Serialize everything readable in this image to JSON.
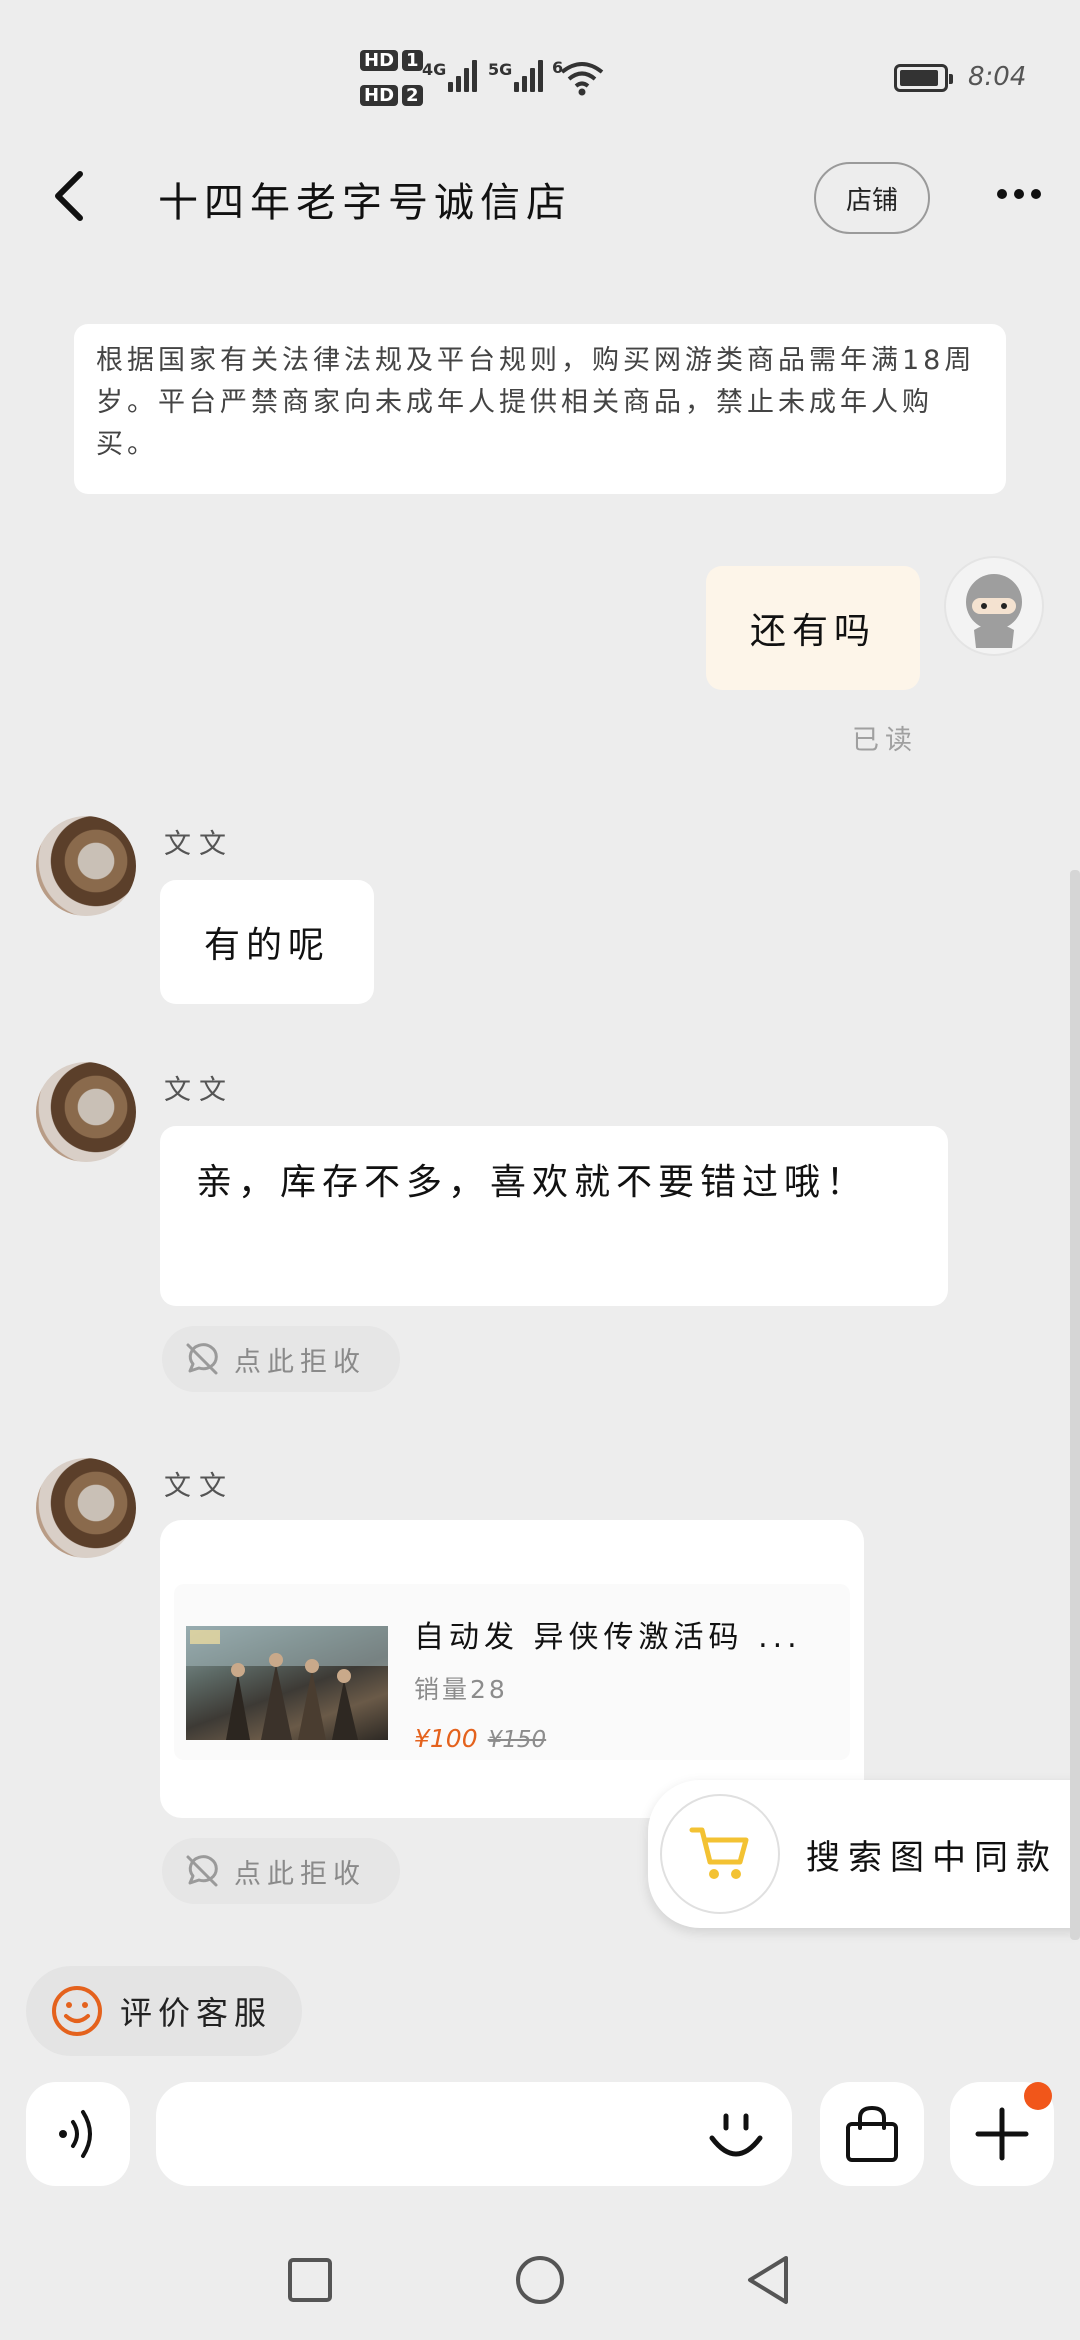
{
  "status_bar": {
    "hd1": "HD",
    "hd1_num": "1",
    "hd2": "HD",
    "hd2_num": "2",
    "signal1": "4G",
    "signal2": "5G",
    "wifi": "6",
    "time": "8:04"
  },
  "header": {
    "title": "十四年老字号诚信店",
    "shop_button": "店铺"
  },
  "notice": {
    "text": "根据国家有关法律法规及平台规则，购买网游类商品需年满18周岁。平台严禁商家向未成年人提供相关商品，禁止未成年人购买。"
  },
  "messages": {
    "me": {
      "text": "还有吗",
      "status": "已读"
    },
    "reply1": {
      "sender": "文文",
      "text": "有的呢"
    },
    "reply2": {
      "sender": "文文",
      "text": "亲，库存不多，喜欢就不要错过哦！",
      "reject": "点此拒收"
    },
    "reply3": {
      "sender": "文文",
      "reject": "点此拒收"
    }
  },
  "product": {
    "title": "自动发 异侠传激活码 ...",
    "sales": "销量28",
    "price": "¥100",
    "old_price": "¥150"
  },
  "search_similar": {
    "label": "搜索图中同款"
  },
  "rate_service": {
    "label": "评价客服"
  },
  "colors": {
    "accent_orange": "#e4621d",
    "badge_red": "#f1561a",
    "cart_yellow": "#f3c233",
    "background": "#ededed",
    "my_bubble": "#fdf5e9"
  },
  "icons": [
    "back-arrow-icon",
    "more-icon",
    "no-receive-icon",
    "cart-icon",
    "smile-icon",
    "voice-icon",
    "emoji-icon",
    "bag-icon",
    "plus-icon",
    "nav-square-icon",
    "nav-circle-icon",
    "nav-back-icon"
  ]
}
